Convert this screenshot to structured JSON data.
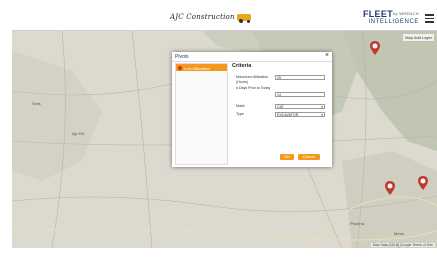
{
  "header": {
    "company_logo_text": "AJC Construction",
    "brand_title": "FLEET",
    "brand_superscript": "by WRENCH",
    "brand_subtitle": "INTELLIGENCE"
  },
  "map": {
    "layer_label": "Map Add Layer",
    "attribution": "Map Data ©2018 Google  Terms of Use",
    "place_labels": [
      "Phoenix",
      "Mesa",
      "Tucson Apt",
      "Ajo Rd",
      "Sells"
    ]
  },
  "dialog": {
    "title": "Pivots",
    "close_glyph": "×",
    "pivots": [
      {
        "label": "Low Utilization"
      }
    ],
    "criteria_title": "Criteria",
    "criteria": [
      {
        "label": "Maximum Utilization (Hours)",
        "value": "25"
      },
      {
        "label": "# Days Prior to Today",
        "value": "14"
      },
      {
        "label": "Make",
        "value": "CAT",
        "dropdown": true
      },
      {
        "label": "Type",
        "value": "EXCAVATOR",
        "dropdown": true
      }
    ],
    "ok_label": "OK",
    "cancel_label": "Cancel"
  },
  "colors": {
    "accent": "#f39a1e",
    "brand": "#1f3d6e",
    "pin": "#c0392b"
  }
}
